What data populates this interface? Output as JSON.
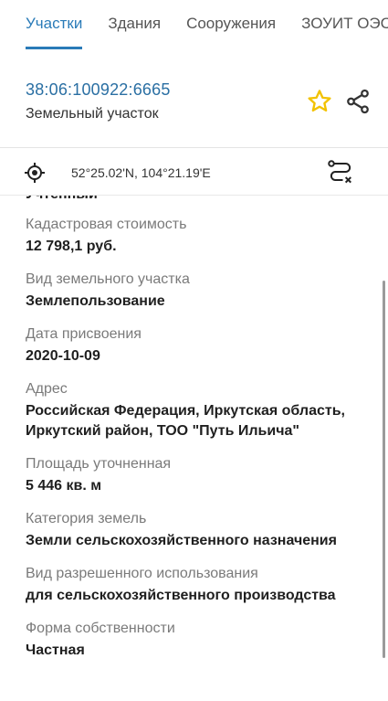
{
  "tabs": [
    {
      "label": "Участки",
      "active": true
    },
    {
      "label": "Здания",
      "active": false
    },
    {
      "label": "Сооружения",
      "active": false
    },
    {
      "label": "ЗОУИТ ОЭС",
      "active": false
    }
  ],
  "parcel": {
    "cadastral_number": "38:06:100922:6665",
    "type": "Земельный участок"
  },
  "coordinates": "52°25.02'N, 104°21.19'E",
  "clipped_value": "Учтенный",
  "fields": [
    {
      "label": "Кадастровая стоимость",
      "value": "12 798,1 руб."
    },
    {
      "label": "Вид земельного участка",
      "value": "Землепользование"
    },
    {
      "label": "Дата присвоения",
      "value": "2020-10-09"
    },
    {
      "label": "Адрес",
      "value": "Российская Федерация, Иркутская область, Иркутский район, ТОО \"Путь Ильича\""
    },
    {
      "label": "Площадь уточненная",
      "value": "5 446 кв. м"
    },
    {
      "label": "Категория земель",
      "value": "Земли сельскохозяйственного назначения"
    },
    {
      "label": "Вид разрешенного использования",
      "value": "для сельскохозяйственного производства"
    },
    {
      "label": "Форма собственности",
      "value": "Частная"
    }
  ],
  "colors": {
    "accent": "#2a7bb8",
    "star": "#f2c200",
    "label": "#7a7a7a"
  },
  "icons": [
    "star-icon",
    "share-icon",
    "target-icon",
    "route-icon"
  ]
}
